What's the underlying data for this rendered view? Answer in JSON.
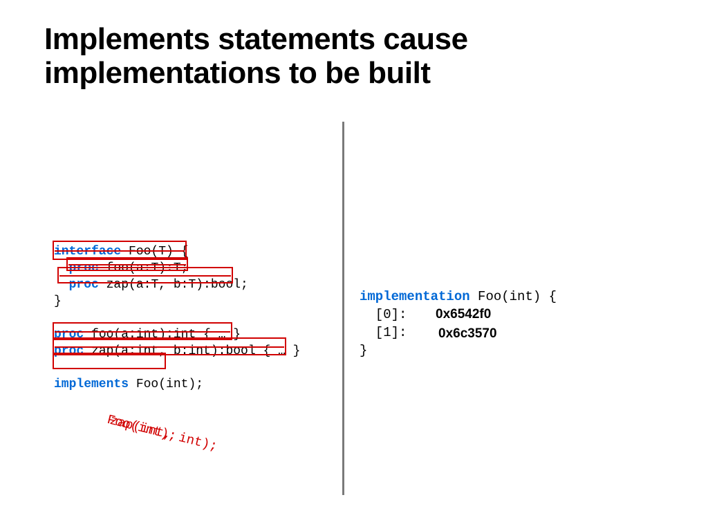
{
  "title": "Implements statements cause implementations to be built",
  "left_code": {
    "l1_kw": "interface",
    "l1_rest": " Foo(T) {",
    "l2_indent": "  ",
    "l2_kw": "proc",
    "l2_rest": " foo(a:T):T;",
    "l3_indent": "  ",
    "l3_kw": "proc",
    "l3_rest": " zap(a:T, b:T):bool;",
    "l4": "}",
    "l5_kw": "proc",
    "l5_rest": " foo(a:int):int { … }",
    "l6_kw": "proc",
    "l6_rest": " zap(a:int, b:int):bool { … }",
    "l7_kw": "implements",
    "l7_rest": " Foo(int);"
  },
  "right_code": {
    "l1_kw": "implementation",
    "l1_rest": " Foo(int) {",
    "l2": "  [0]:",
    "l3": "  [1]:",
    "l4": "}"
  },
  "addresses": {
    "addr0": "0x6542f0",
    "addr1": "0x6c3570"
  },
  "annotations": {
    "rot1": "Foo(int);",
    "rot2": "zap(int, int);"
  }
}
